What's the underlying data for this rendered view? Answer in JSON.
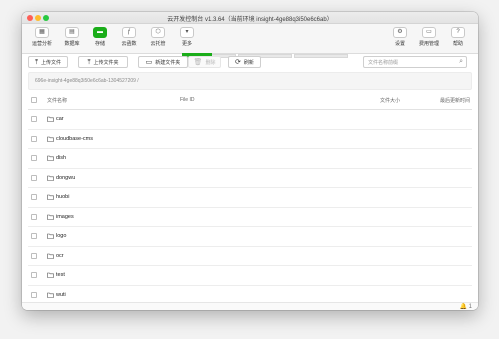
{
  "window": {
    "title": "云开发控制台 v1.3.64（当前环境 insight-4ge88q3i50e6c6ab）"
  },
  "toolbar": {
    "items": [
      {
        "label": "运营分析",
        "icon": "chart-icon"
      },
      {
        "label": "数据库",
        "icon": "database-icon"
      },
      {
        "label": "存储",
        "icon": "storage-icon",
        "active": true
      },
      {
        "label": "云函数",
        "icon": "function-icon"
      },
      {
        "label": "云托管",
        "icon": "cloud-hosting-icon"
      },
      {
        "label": "更多",
        "icon": "more-icon"
      },
      {
        "label": "设置",
        "icon": "gear-icon"
      },
      {
        "label": "费用管理",
        "icon": "billing-icon"
      },
      {
        "label": "帮助",
        "icon": "help-icon"
      }
    ]
  },
  "actions": {
    "upload_file": "上传文件",
    "upload_folder": "上传文件夹",
    "new_folder": "新建文件夹",
    "delete": "删除",
    "refresh": "刷新",
    "search_placeholder": "文件名称前缀"
  },
  "path": "696e-insight-4ge88q3i50e6c6ab-1304527209 /",
  "table": {
    "columns": [
      "文件名称",
      "File ID",
      "文件大小",
      "最后更新时间"
    ],
    "rows": [
      {
        "name": "car"
      },
      {
        "name": "cloudbase-cms"
      },
      {
        "name": "dish"
      },
      {
        "name": "dongwu"
      },
      {
        "name": "huobi"
      },
      {
        "name": "images"
      },
      {
        "name": "logo"
      },
      {
        "name": "ocr"
      },
      {
        "name": "test"
      },
      {
        "name": "wuti"
      }
    ]
  },
  "status": {
    "notification_count": "1"
  },
  "colors": {
    "accent": "#1aad19"
  }
}
